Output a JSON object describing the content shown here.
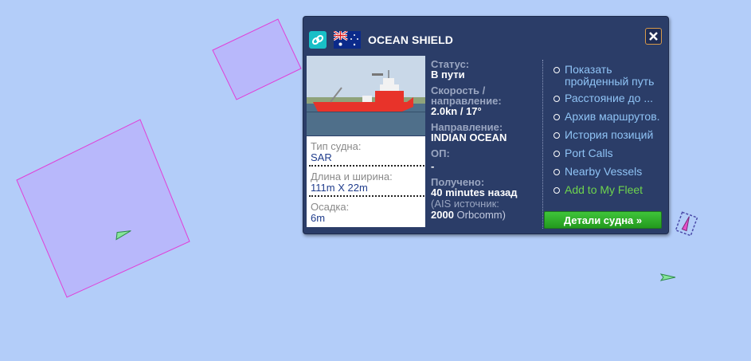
{
  "map": {
    "background": "#b3cdf9",
    "zone_stroke": "#e040d8",
    "zone_fill": "#b8b8fb"
  },
  "vessel": {
    "name": "OCEAN SHIELD",
    "flag": "australia-flag",
    "photo": {
      "hull_color": "#e8332a",
      "sea_color": "#4f6f8a",
      "sky_color": "#c9d8e8"
    },
    "specs": [
      {
        "label": "Тип судна:",
        "value": "SAR"
      },
      {
        "label": "Длина и ширина:",
        "value": "111m X 22m"
      },
      {
        "label": "Осадка:",
        "value": "6m"
      }
    ],
    "status": {
      "status_label": "Статус:",
      "status_value": "В пути",
      "speed_label_1": "Скорость /",
      "speed_label_2": "направление:",
      "speed_value": "2.0kn / 17°",
      "dest_label": "Направление:",
      "dest_value": "INDIAN OCEAN",
      "eta_label": "ОП:",
      "eta_value": "-",
      "received_label": "Получено:",
      "received_value": "40 minutes назад",
      "ais_prefix": "(AIS источник:",
      "ais_id": "2000",
      "ais_name": "Orbcomm)"
    },
    "links": [
      "Показать пройденный путь",
      "Расстояние до ...",
      "Архив маршрутов.",
      "История позиций",
      "Port Calls",
      "Nearby Vessels",
      "Add to My Fleet"
    ],
    "details_button": "Детали судна »"
  }
}
